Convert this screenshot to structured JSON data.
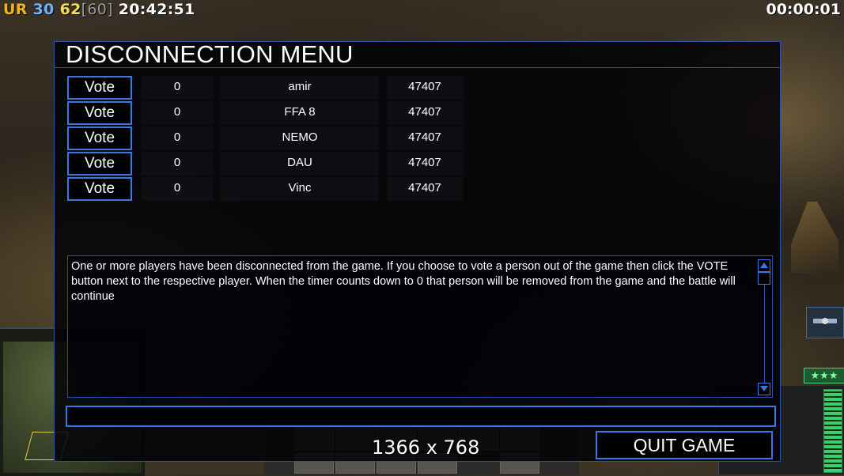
{
  "hud": {
    "faction": "UR",
    "units": "30",
    "fps": "62",
    "fps_max": "[60]",
    "clock": "20:42:51",
    "game_timer": "00:00:01",
    "rank_stars": "★★★"
  },
  "dialog": {
    "title": "DISCONNECTION MENU",
    "players": [
      {
        "vote_label": "Vote",
        "count": "0",
        "name": "amir",
        "port": "47407"
      },
      {
        "vote_label": "Vote",
        "count": "0",
        "name": "FFA 8",
        "port": "47407"
      },
      {
        "vote_label": "Vote",
        "count": "0",
        "name": "NEMO",
        "port": "47407"
      },
      {
        "vote_label": "Vote",
        "count": "0",
        "name": "DAU",
        "port": "47407"
      },
      {
        "vote_label": "Vote",
        "count": "0",
        "name": "Vinc",
        "port": "47407"
      }
    ],
    "message": "One or more players have been disconnected from the game. If you choose to vote a person out of the game then click  the VOTE button next to the respective player. When the timer counts down to 0 that person will be removed from the game and the battle will continue",
    "chat_value": "",
    "quit_label": "QUIT GAME"
  },
  "overlay": {
    "resolution": "1366 x 768"
  },
  "colors": {
    "accent_border": "#3a78e8",
    "panel_border": "#2e4fb0",
    "faction": "#f2b41e",
    "units": "#6fb4ff",
    "fps": "#f4e04a"
  }
}
